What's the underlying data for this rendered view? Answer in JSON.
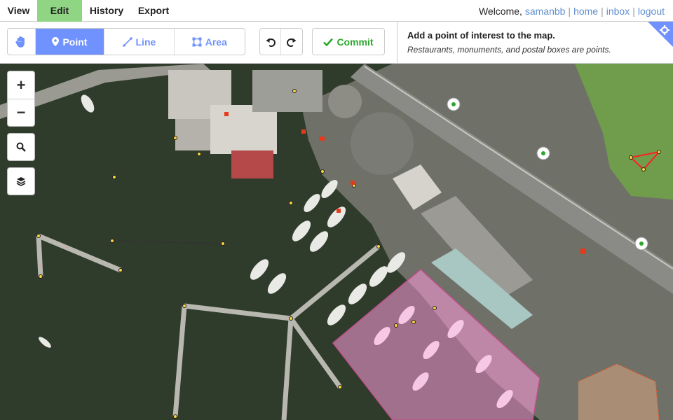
{
  "nav": {
    "view": "View",
    "edit": "Edit",
    "history": "History",
    "export": "Export"
  },
  "user": {
    "welcome": "Welcome,",
    "username": "samanbb",
    "home": "home",
    "inbox": "inbox",
    "logout": "logout"
  },
  "toolbar": {
    "point": "Point",
    "line": "Line",
    "area": "Area",
    "commit": "Commit"
  },
  "info": {
    "title": "Add a point of interest to the map.",
    "description": "Restaurants, monuments, and postal boxes are points."
  },
  "colors": {
    "accent": "#7092ff",
    "commit": "#2ca72c",
    "edit_active": "#8fd584",
    "link": "#5e8ed0",
    "highlight_area": "#ff9bdc"
  },
  "map_controls": {
    "zoom_in": "+",
    "zoom_out": "−"
  }
}
